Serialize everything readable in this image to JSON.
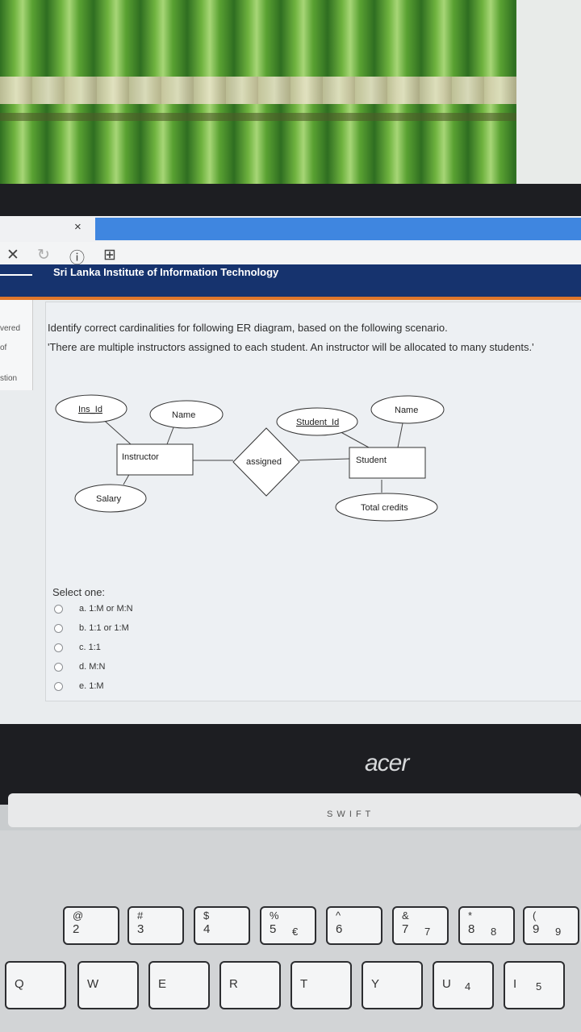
{
  "browser": {
    "tab_close": "×",
    "close_btn": "✕",
    "reload_btn": "↻",
    "info_btn": "ⓘ",
    "page_btn": "⊞"
  },
  "site": {
    "title": "Sri Lanka Institute of Information Technology"
  },
  "sidebar": {
    "lines": [
      "vered",
      "of",
      "stion"
    ]
  },
  "question": {
    "line1": "Identify correct cardinalities for following ER diagram, based on the following scenario.",
    "line2": "'There are multiple instructors assigned to each student. An instructor will be allocated to many students.'",
    "select_label": "Select one:",
    "options": [
      "a. 1:M or M:N",
      "b. 1:1 or 1:M",
      "c. 1:1",
      "d. M:N",
      "e. 1:M"
    ]
  },
  "er_diagram": {
    "entities": [
      "Instructor",
      "Student"
    ],
    "relationship": "assigned",
    "attributes": [
      "Ins_Id",
      "Name",
      "Salary",
      "Student_Id",
      "Name",
      "Total credits"
    ]
  },
  "laptop": {
    "brand": "acer",
    "fn_labels": "S   W   I   F   T"
  },
  "keys": {
    "row_num": [
      {
        "main": "2",
        "top": "@"
      },
      {
        "main": "3",
        "top": "#"
      },
      {
        "main": "4",
        "top": "$"
      },
      {
        "main": "5",
        "top": "%",
        "sec": "€"
      },
      {
        "main": "6",
        "top": "^"
      },
      {
        "main": "7",
        "top": "&",
        "sec": "7"
      },
      {
        "main": "8",
        "top": "*",
        "sec": "8"
      },
      {
        "main": "9",
        "top": "(",
        "sec": "9"
      }
    ],
    "row_q": [
      "Q",
      "W",
      "E",
      "R",
      "T",
      "Y",
      "U",
      "I"
    ],
    "row_q_sec": {
      "u": "4",
      "i": "5"
    }
  }
}
